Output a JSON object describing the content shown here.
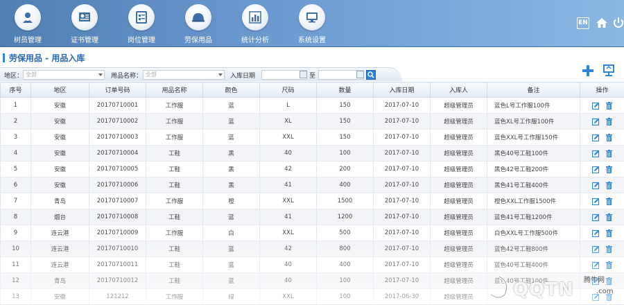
{
  "nav": {
    "items": [
      {
        "label": "树员管理",
        "icon": "person-badge-icon"
      },
      {
        "label": "证书管理",
        "icon": "certificate-icon"
      },
      {
        "label": "岗位管理",
        "icon": "list-card-icon"
      },
      {
        "label": "劳保用品",
        "icon": "helmet-icon"
      },
      {
        "label": "统计分析",
        "icon": "bar-chart-icon"
      },
      {
        "label": "系统设置",
        "icon": "monitor-icon"
      }
    ],
    "lang": "EN"
  },
  "page_title": "劳保用品 - 用品入库",
  "filters": {
    "area_label": "地区：",
    "area_value": "全部",
    "item_label": "用品名称：",
    "item_value": "全部",
    "date_label": "入库日期",
    "date_sep": "至"
  },
  "table": {
    "headers": [
      "序号",
      "地区",
      "订单号码",
      "用品名称",
      "颜色",
      "尺码",
      "数量",
      "入库日期",
      "入库人",
      "备注",
      "操作"
    ],
    "rows": [
      [
        "1",
        "安徽",
        "20170710001",
        "工作服",
        "蓝",
        "L",
        "150",
        "2017-07-10",
        "超级管理员",
        "蓝色L号工作服100件"
      ],
      [
        "2",
        "安徽",
        "20170710002",
        "工作服",
        "蓝",
        "XL",
        "150",
        "2017-07-10",
        "超级管理员",
        "蓝色XL号工作服100件"
      ],
      [
        "3",
        "安徽",
        "20170710003",
        "工作服",
        "蓝",
        "XXL",
        "150",
        "2017-07-10",
        "超级管理员",
        "蓝色XXL号工作服150件"
      ],
      [
        "4",
        "安徽",
        "20170710004",
        "工鞋",
        "黑",
        "40",
        "100",
        "2017-07-10",
        "超级管理员",
        "黑色40号工鞋100件"
      ],
      [
        "5",
        "安徽",
        "20170710005",
        "工鞋",
        "黑",
        "42",
        "200",
        "2017-07-10",
        "超级管理员",
        "黑色42号工鞋200件"
      ],
      [
        "6",
        "安徽",
        "20170710006",
        "工鞋",
        "黑",
        "41",
        "400",
        "2017-07-10",
        "超级管理员",
        "黑色41号工鞋400件"
      ],
      [
        "7",
        "青岛",
        "20170710007",
        "工作服",
        "橙",
        "XXL",
        "1500",
        "2017-07-10",
        "超级管理员",
        "橙色XXL工作服1500件"
      ],
      [
        "8",
        "烟台",
        "20170710008",
        "工鞋",
        "蓝",
        "41",
        "1200",
        "2017-07-10",
        "超级管理员",
        "蓝色41号工鞋1200件"
      ],
      [
        "9",
        "连云港",
        "20170710009",
        "工作服",
        "白",
        "XXL",
        "500",
        "2017-07-10",
        "超级管理员",
        "白色XXL号工作服500件"
      ],
      [
        "10",
        "连云港",
        "20170710010",
        "工鞋",
        "蓝",
        "42",
        "800",
        "2017-07-10",
        "超级管理员",
        "蓝色42号工鞋800件"
      ],
      [
        "11",
        "连云港",
        "20170710011",
        "工鞋",
        "蓝",
        "40",
        "400",
        "2017-07-10",
        "超级管理员",
        "蓝色40号工鞋400件"
      ],
      [
        "12",
        "青岛",
        "20170710012",
        "工鞋",
        "蓝",
        "40",
        "100",
        "2017-07-10",
        "超级管理员",
        "蓝色40号工鞋100件"
      ],
      [
        "13",
        "安徽",
        "121212",
        "工作服",
        "绿",
        "XXL",
        "100",
        "2017-06-30",
        "超级管理员",
        ""
      ]
    ]
  },
  "watermark": {
    "text": "QQTN",
    "cn": "腾牛网",
    "suffix": ".com"
  },
  "colors": {
    "nav_start": "#4f7fb3",
    "nav_end": "#8bb7e2",
    "accent": "#2d86d9",
    "title": "#2467b3"
  }
}
